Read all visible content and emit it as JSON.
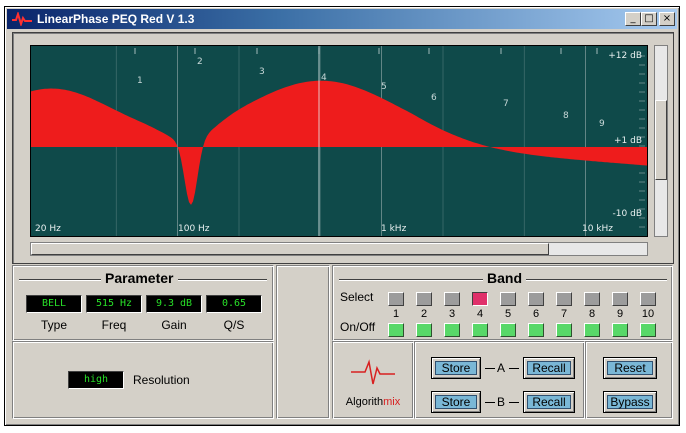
{
  "window": {
    "title": "LinearPhase PEQ Red  V 1.3",
    "controls": {
      "minimize": "_",
      "maximize": "□",
      "close": "×"
    }
  },
  "graph": {
    "freq_labels": [
      "20 Hz",
      "100 Hz",
      "1 kHz",
      "10 kHz"
    ],
    "db_labels": [
      "+12 dB",
      "+1 dB",
      "-10 dB"
    ],
    "band_markers": [
      "1",
      "2",
      "3",
      "4",
      "5",
      "6",
      "7",
      "8",
      "9"
    ],
    "colors": {
      "background": "#0f4a4a",
      "curve": "#ee1c1c",
      "grid": "#9ab0b0"
    }
  },
  "parameter": {
    "title": "Parameter",
    "fields": [
      {
        "label": "Type",
        "value": "BELL"
      },
      {
        "label": "Freq",
        "value": "515 Hz"
      },
      {
        "label": "Gain",
        "value": "9.3 dB"
      },
      {
        "label": "Q/S",
        "value": "0.65"
      }
    ],
    "resolution": {
      "label": "Resolution",
      "value": "high"
    }
  },
  "band": {
    "title": "Band",
    "select_label": "Select",
    "onoff_label": "On/Off",
    "numbers": [
      "1",
      "2",
      "3",
      "4",
      "5",
      "6",
      "7",
      "8",
      "9",
      "10"
    ],
    "selected": 4
  },
  "logo": {
    "prefix": "Algorith",
    "suffix": "mix"
  },
  "ab": {
    "a_label": "A",
    "b_label": "B",
    "store": "Store",
    "recall": "Recall"
  },
  "actions": {
    "reset": "Reset",
    "bypass": "Bypass"
  }
}
